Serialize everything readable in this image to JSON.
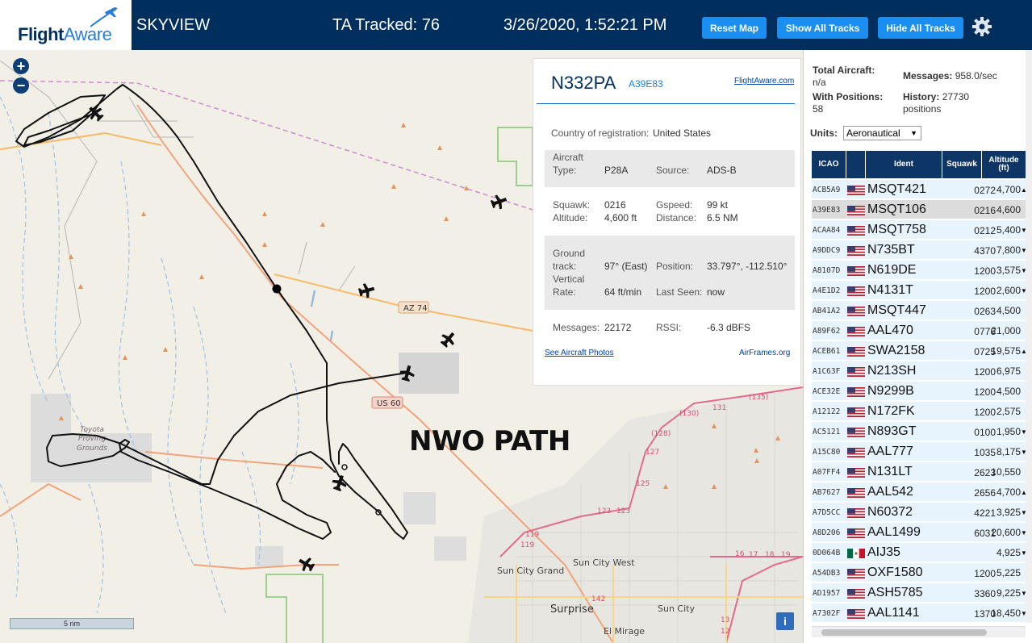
{
  "header": {
    "logo_flight": "Flight",
    "logo_aware": "Aware",
    "app_title": "SKYVIEW",
    "tracked": "TA Tracked: 76",
    "datetime": "3/26/2020, 1:52:21 PM",
    "reset_label": "Reset Map",
    "show_label": "Show All Tracks",
    "hide_label": "Hide All Tracks",
    "settings_icon": "gear-icon"
  },
  "map": {
    "zoom_in": "+",
    "zoom_out": "−",
    "scale_label": "5 nm",
    "info_label": "i",
    "overlay_text": "NWO PATH",
    "road_labels": [
      "AZ 74",
      "US 60"
    ],
    "place_labels": [
      "Toyota",
      "Proving",
      "Grounds",
      "Sun City West",
      "Sun City Grand",
      "Surprise",
      "Sun City",
      "El Mirage"
    ],
    "route_numbers": [
      "131",
      "(135)",
      "(130)",
      "(128)",
      "127",
      "125",
      "123",
      "123",
      "119",
      "119",
      "142",
      "17",
      "16",
      "18",
      "19",
      "12",
      "13",
      "(128)",
      "125"
    ]
  },
  "popup": {
    "registration": "N332PA",
    "hex": "A39E83",
    "fa_link": "FlightAware.com",
    "country_label": "Country of registration:",
    "country_value": "United States",
    "aircraft_label": "Aircraft",
    "type_label": "Type:",
    "type_value": "P28A",
    "source_label": "Source:",
    "source_value": "ADS-B",
    "squawk_label": "Squawk:",
    "squawk_value": "0216",
    "gspeed_label": "Gspeed:",
    "gspeed_value": "99 kt",
    "altitude_label": "Altitude:",
    "altitude_value": "4,600 ft",
    "distance_label": "Distance:",
    "distance_value": "6.5 NM",
    "ground_label": "Ground",
    "track_label": "track:",
    "track_value": "97° (East)",
    "position_label": "Position:",
    "position_value": "33.797°, -112.510°",
    "vertical_label": "Vertical",
    "rate_label": "Rate:",
    "rate_value": "64 ft/min",
    "lastseen_label": "Last Seen:",
    "lastseen_value": "now",
    "messages_label": "Messages:",
    "messages_value": "22172",
    "rssi_label": "RSSI:",
    "rssi_value": "-6.3 dBFS",
    "photos_link": "See Aircraft Photos",
    "airframes_link": "AirFrames.org"
  },
  "stats": {
    "total_label": "Total Aircraft:",
    "total_value": "n/a",
    "messages_label": "Messages:",
    "messages_value": "958.0/sec",
    "withpos_label": "With Positions:",
    "withpos_value": "58",
    "history_label": "History:",
    "history_value": "27730",
    "history_unit": "positions",
    "units_label": "Units:",
    "units_value": "Aeronautical"
  },
  "table": {
    "headers": {
      "icao": "ICAO",
      "ident": "Ident",
      "squawk": "Squawk",
      "altitude": "Altitude",
      "altitude_unit": "(ft)"
    },
    "rows": [
      {
        "icao": "ACB5A9",
        "flag": "us",
        "ident": "MSQT421",
        "squawk": "0272",
        "alt": "4,700",
        "arrow": "▲"
      },
      {
        "icao": "A39E83",
        "flag": "us",
        "ident": "MSQT106",
        "squawk": "0216",
        "alt": "4,600",
        "arrow": ""
      },
      {
        "icao": "ACAA84",
        "flag": "us",
        "ident": "MSQT758",
        "squawk": "0212",
        "alt": "5,400",
        "arrow": "▼"
      },
      {
        "icao": "A9DDC9",
        "flag": "us",
        "ident": "N735BT",
        "squawk": "4370",
        "alt": "7,800",
        "arrow": "▼"
      },
      {
        "icao": "A8107D",
        "flag": "us",
        "ident": "N619DE",
        "squawk": "1200",
        "alt": "3,575",
        "arrow": "▼"
      },
      {
        "icao": "A4E1D2",
        "flag": "us",
        "ident": "N4131T",
        "squawk": "1200",
        "alt": "2,600",
        "arrow": "▼"
      },
      {
        "icao": "AB41A2",
        "flag": "us",
        "ident": "MSQT447",
        "squawk": "0263",
        "alt": "4,500",
        "arrow": ""
      },
      {
        "icao": "A89F62",
        "flag": "us",
        "ident": "AAL470",
        "squawk": "0776",
        "alt": "21,000",
        "arrow": ""
      },
      {
        "icao": "ACEB61",
        "flag": "us",
        "ident": "SWA2158",
        "squawk": "0725",
        "alt": "19,575",
        "arrow": "▲"
      },
      {
        "icao": "A1C63F",
        "flag": "us",
        "ident": "N213SH",
        "squawk": "1200",
        "alt": "6,975",
        "arrow": ""
      },
      {
        "icao": "ACE32E",
        "flag": "us",
        "ident": "N9299B",
        "squawk": "1200",
        "alt": "4,500",
        "arrow": ""
      },
      {
        "icao": "A12122",
        "flag": "us",
        "ident": "N172FK",
        "squawk": "1200",
        "alt": "2,575",
        "arrow": ""
      },
      {
        "icao": "AC5121",
        "flag": "us",
        "ident": "N893GT",
        "squawk": "0100",
        "alt": "1,950",
        "arrow": "▼"
      },
      {
        "icao": "A15C80",
        "flag": "us",
        "ident": "AAL777",
        "squawk": "1035",
        "alt": "8,175",
        "arrow": "▼"
      },
      {
        "icao": "A07FF4",
        "flag": "us",
        "ident": "N131LT",
        "squawk": "2623",
        "alt": "10,550",
        "arrow": ""
      },
      {
        "icao": "AB7627",
        "flag": "us",
        "ident": "AAL542",
        "squawk": "2656",
        "alt": "4,700",
        "arrow": "▲"
      },
      {
        "icao": "A7D5CC",
        "flag": "us",
        "ident": "N60372",
        "squawk": "4221",
        "alt": "3,925",
        "arrow": "▼"
      },
      {
        "icao": "A8D206",
        "flag": "us",
        "ident": "AAL1499",
        "squawk": "6031",
        "alt": "20,600",
        "arrow": "▼"
      },
      {
        "icao": "0D064B",
        "flag": "mx",
        "ident": "AIJ35",
        "squawk": "",
        "alt": "4,925",
        "arrow": "▼"
      },
      {
        "icao": "A54DB3",
        "flag": "us",
        "ident": "OXF1580",
        "squawk": "1200",
        "alt": "5,225",
        "arrow": ""
      },
      {
        "icao": "AD1957",
        "flag": "us",
        "ident": "ASH5785",
        "squawk": "3360",
        "alt": "9,225",
        "arrow": "▼"
      },
      {
        "icao": "A7302F",
        "flag": "us",
        "ident": "AAL1141",
        "squawk": "1370",
        "alt": "18,450",
        "arrow": "▼"
      }
    ],
    "selected_index": 1
  }
}
